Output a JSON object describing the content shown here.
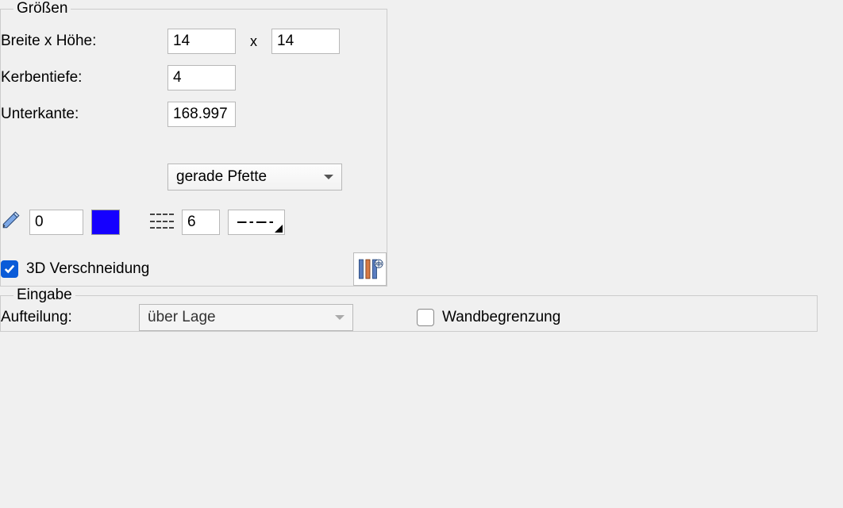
{
  "groups": {
    "groessen": {
      "legend": "Größen"
    },
    "eingabe": {
      "legend": "Eingabe"
    }
  },
  "sizes": {
    "width_x_height_label": "Breite x Höhe:",
    "width_value": "14",
    "x_separator": "x",
    "height_value": "14",
    "notch_depth_label": "Kerbentiefe:",
    "notch_depth_value": "4",
    "bottom_edge_label": "Unterkante:",
    "bottom_edge_value": "168.997"
  },
  "purlin_type": {
    "selected": "gerade Pfette"
  },
  "pen": {
    "layer_value": "0",
    "color_hex": "#1500ff",
    "line_weight_value": "6"
  },
  "options": {
    "intersection3d_label": "3D Verschneidung",
    "intersection3d_checked": true
  },
  "input": {
    "distribution_label": "Aufteilung:",
    "distribution_selected": "über Lage",
    "wall_limit_label": "Wandbegrenzung",
    "wall_limit_checked": false
  },
  "icons": {
    "pencil": "pencil-icon",
    "hatch": "hatch-icon",
    "profile": "profile-icon",
    "chevron_down": "chevron-down-icon",
    "check": "check-icon"
  }
}
